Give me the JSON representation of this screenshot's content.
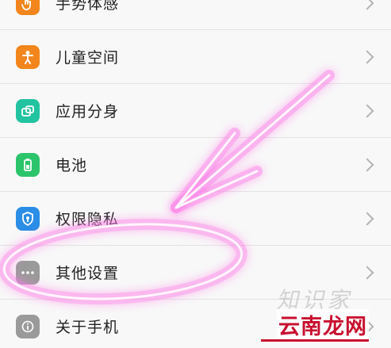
{
  "settings_list": {
    "items": [
      {
        "label": "手势体感",
        "icon": "hand-gesture-icon",
        "color": "#f2861c"
      },
      {
        "label": "儿童空间",
        "icon": "child-icon",
        "color": "#f2861c"
      },
      {
        "label": "应用分身",
        "icon": "app-clone-icon",
        "color": "#22c3a0"
      },
      {
        "label": "电池",
        "icon": "battery-icon",
        "color": "#2cc46b"
      },
      {
        "label": "权限隐私",
        "icon": "shield-icon",
        "color": "#2a8de6"
      },
      {
        "label": "其他设置",
        "icon": "more-dots-icon",
        "color": "#9a9a9a"
      },
      {
        "label": "关于手机",
        "icon": "info-icon",
        "color": "#9a9a9a"
      }
    ]
  },
  "annotation": {
    "stroke_color": "#ff4fd8",
    "glow_color": "#ff7ae8"
  },
  "watermark": {
    "faint_text": "知识家",
    "main_text": "云南龙网",
    "color": "#c8102e"
  }
}
